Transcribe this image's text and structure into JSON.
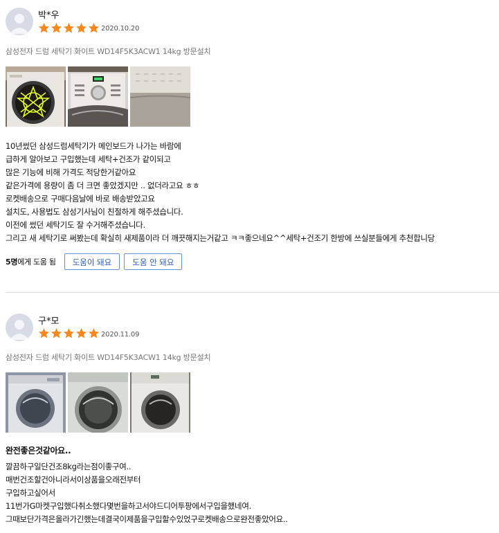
{
  "reviews": [
    {
      "name": "박*우",
      "rating": 5,
      "date": "2020.10.20",
      "product": "삼성전자 드럼 세탁기 화이트 WD14F5K3ACW1 14kg 방문설치",
      "photos": [
        "washer-door-glow-photo",
        "washer-control-panel-photo",
        "washer-top-panel-photo"
      ],
      "headline": "",
      "lines": [
        "10년썼던 삼성드럼세탁기가 메인보드가 나가는 바람에",
        "급하게 알아보고 구입했는데 세탁+건조가 같이되고",
        "많은 기능에 비해 가격도 적당한거같아요",
        "같은가격에 용량이 좀 더 크면 좋았겠지만 .. 없더라고요 ㅎㅎ",
        "로켓배송으로 구매다음날에 바로 배송받았고요",
        "설치도, 사용법도 삼성기사님이 친절하게 해주셨습니다.",
        "이전에 썼던 세탁기도 잘 수거해주셨습니다.",
        "그리고 새 세탁기로 써봤는데 확실히 새제품이라 더 깨끗해지는거같고 ㅋㅋ좋으네요^^세탁+건조기 한방에 쓰실분들에게 추천합니당"
      ],
      "helpful_count": "5명",
      "helpful_suffix": "에게 도움 됨",
      "helpful_button": "도움이 돼요",
      "not_helpful_button": "도움 안 돼요"
    },
    {
      "name": "구*모",
      "rating": 5,
      "date": "2020.11.09",
      "product": "삼성전자 드럼 세탁기 화이트 WD14F5K3ACW1 14kg 방문설치",
      "photos": [
        "washer-front-photo",
        "washer-door-closeup-photo",
        "washer-installed-photo"
      ],
      "headline": "완전좋은것같아요..",
      "lines": [
        "깔끔하구일단건조8kg라는점이좋구여..",
        "매번건조할건아니라서이상품을오래전부터",
        "구입하고싶어서",
        "11번가G마켓구입했다취소했다몇번을하고서야드디어투팡에서구입을했네여.",
        "그때보단가격은올라가긴했는데결국이제품을구입할수있었구로켓배송으로완전좋았어요.."
      ]
    }
  ],
  "colors": {
    "star": "#f5891f",
    "button_border": "#6a8fd6",
    "button_text": "#2d5cc0",
    "divider": "#dddddd",
    "avatar": "#d6dbe4"
  }
}
